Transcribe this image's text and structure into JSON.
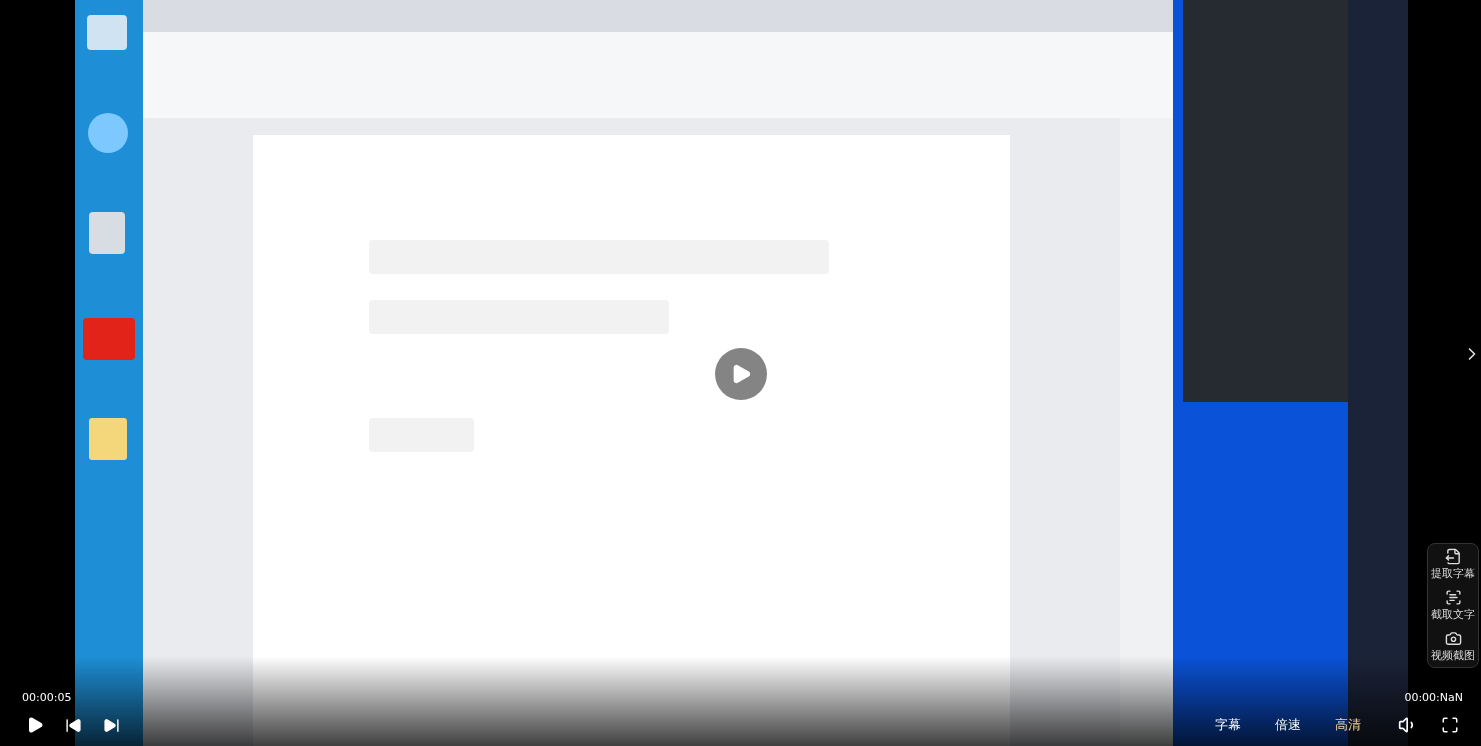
{
  "video": {
    "kind": "picture",
    "playing": false,
    "current_time": "00:00:05",
    "duration": "00:00:NaN"
  },
  "controls": [
    {
      "label": "字幕",
      "selected": false
    },
    {
      "label": "倍速",
      "selected": false
    },
    {
      "label": "高清",
      "selected": true
    }
  ],
  "tools": [
    {
      "kind": "subtitle",
      "label": "提取字幕"
    },
    {
      "kind": "text",
      "label": "截取文字"
    },
    {
      "kind": "camera",
      "label": "视频截图"
    }
  ]
}
